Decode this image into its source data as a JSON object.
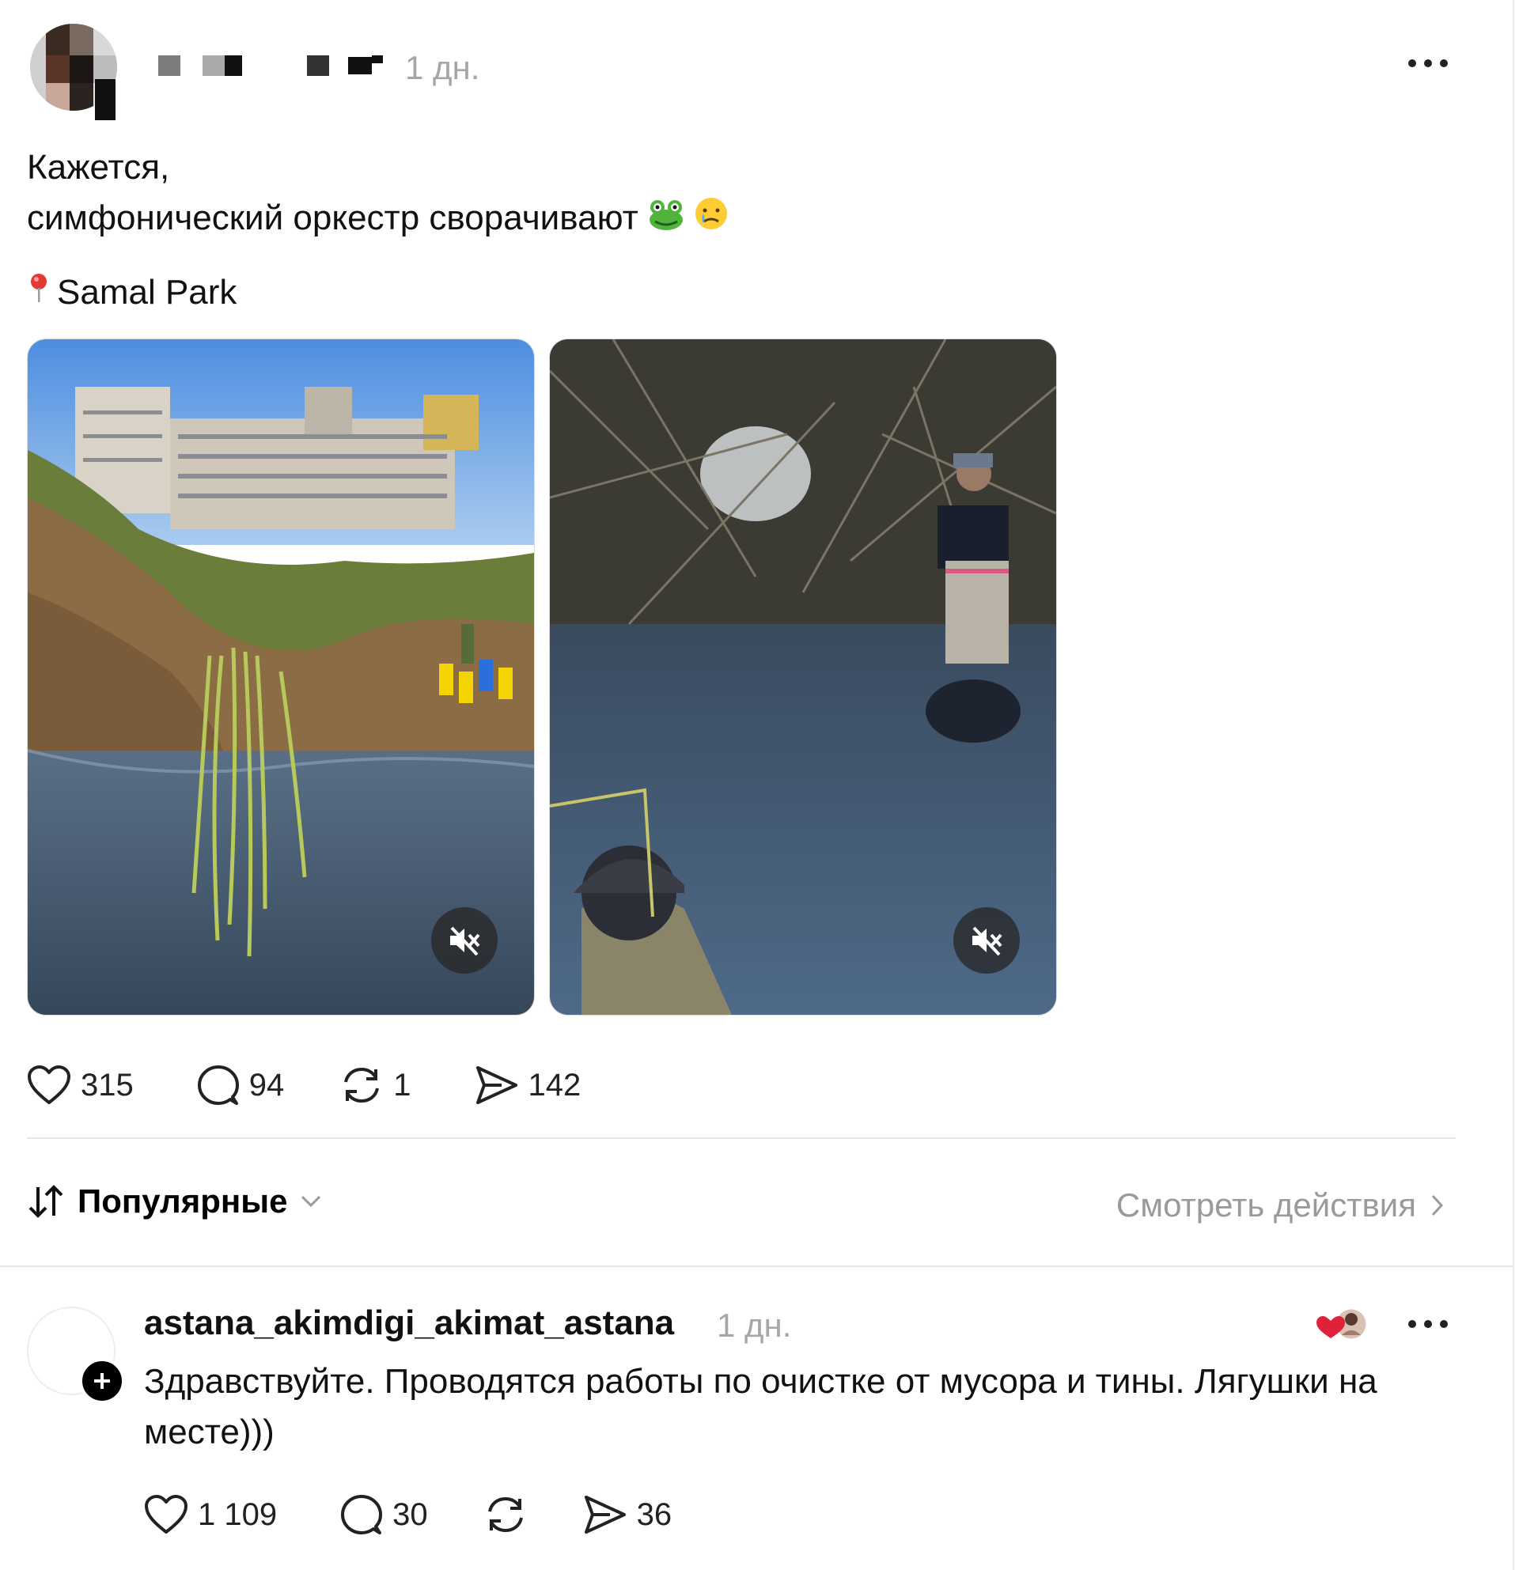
{
  "post": {
    "time": "1 дн.",
    "caption_line1": "Кажется,",
    "caption_line2": "симфонический оркестр сворачивают",
    "caption_emojis": [
      "frog-icon",
      "crying-face-icon"
    ],
    "location_icon": "pin-icon",
    "location": "Samal Park",
    "media": [
      {
        "kind": "video",
        "scene": "pond-with-buildings",
        "muted_icon": "speaker-muted-icon"
      },
      {
        "kind": "video",
        "scene": "worker-in-water",
        "muted_icon": "speaker-muted-icon"
      }
    ],
    "stats": {
      "likes": "315",
      "comments": "94",
      "reposts": "1",
      "shares": "142"
    }
  },
  "sort": {
    "icon": "sort-arrows-icon",
    "label": "Популярные"
  },
  "view_actions": {
    "label": "Смотреть действия"
  },
  "reply": {
    "username": "astana_akimdigi_akimat_astana",
    "time": "1 дн.",
    "text": "Здравствуйте. Проводятся работы по очистке от мусора и тины. Лягушки на месте)))",
    "stats": {
      "likes": "1 109",
      "comments": "30",
      "shares": "36"
    }
  },
  "colors": {
    "muted_text": "#a6a6a6",
    "divider": "#e6e6e6",
    "like_red": "#e0213a"
  }
}
